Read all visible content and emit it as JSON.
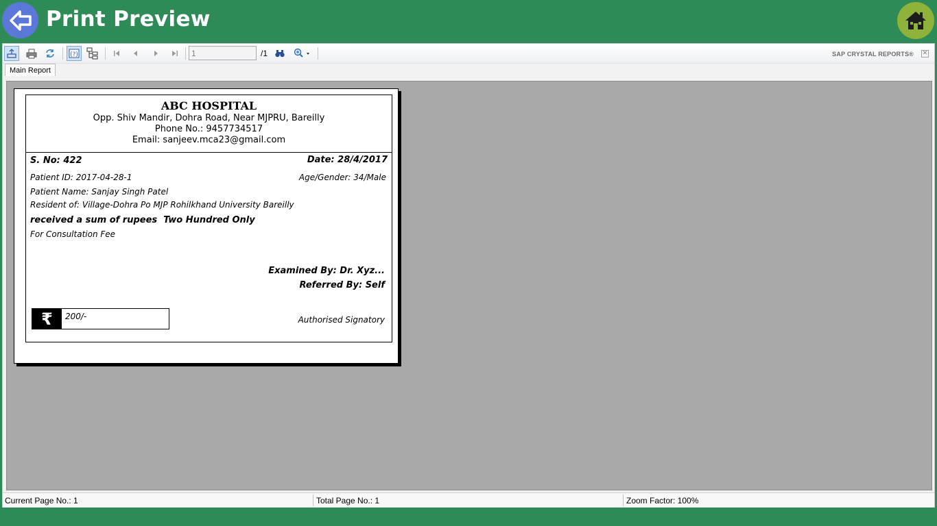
{
  "header": {
    "title": "Print Preview",
    "back_icon": "back-arrow-icon",
    "home_icon": "home-icon",
    "colors": {
      "bar": "#2e8b57",
      "back": "#5b78d8",
      "home": "#8fb23a"
    }
  },
  "toolbar": {
    "page_value": "1",
    "page_total": "/1",
    "brand": "SAP CRYSTAL REPORTS®",
    "close": "✕"
  },
  "tabs": [
    {
      "label": "Main Report"
    }
  ],
  "receipt": {
    "hospital_name": "ABC HOSPITAL",
    "address": "Opp. Shiv Mandir, Dohra Road, Near MJPRU, Bareilly",
    "phone": "Phone No.: 9457734517",
    "email": "Email: sanjeev.mca23@gmail.com",
    "serial_no": "S. No: 422",
    "date": "Date: 28/4/2017",
    "patient_id": "Patient ID: 2017-04-28-1",
    "age_gender": "Age/Gender: 34/Male",
    "patient_name": "Patient Name: Sanjay Singh Patel",
    "resident": "Resident of: Village-Dohra Po MJP Rohilkhand University Bareilly",
    "received_sum": "received a sum of rupees  Two Hundred Only",
    "purpose": "For Consultation Fee",
    "examined_by": "Examined By: Dr. Xyz...",
    "referred_by": "Referred By: Self",
    "rupee_symbol": "₹",
    "amount": "200/-",
    "signatory": "Authorised Signatory"
  },
  "status_bar": {
    "current_page": "Current Page No.: 1",
    "total_page": "Total Page No.: 1",
    "zoom": "Zoom Factor: 100%"
  }
}
